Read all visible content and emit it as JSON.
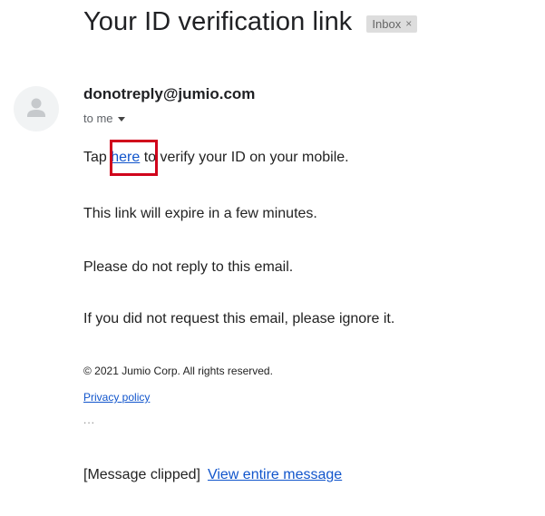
{
  "email": {
    "subject": "Your ID verification link",
    "label": "Inbox",
    "label_remove": "×",
    "sender": "donotreply@jumio.com",
    "recipient": "to me",
    "body": {
      "line1_before": "Tap ",
      "line1_link": "here",
      "line1_after": " to verify your ID on your mobile.",
      "line2": "This link will expire in a few minutes.",
      "line3": "Please do not reply to this email.",
      "line4": "If you did not request this email, please ignore it."
    },
    "footer": {
      "copyright": "© 2021 Jumio Corp. All rights reserved.",
      "privacy_link": "Privacy policy",
      "ellipsis": "..."
    },
    "clipped": {
      "text": "[Message clipped]",
      "link": "View entire message"
    }
  },
  "icons": {
    "avatar": "default-avatar-icon",
    "recipient_caret": "caret-down-icon",
    "label_remove": "close-icon"
  },
  "colors": {
    "link": "#1155cc",
    "highlight": "#d0021b",
    "label_bg": "#dddddd"
  }
}
